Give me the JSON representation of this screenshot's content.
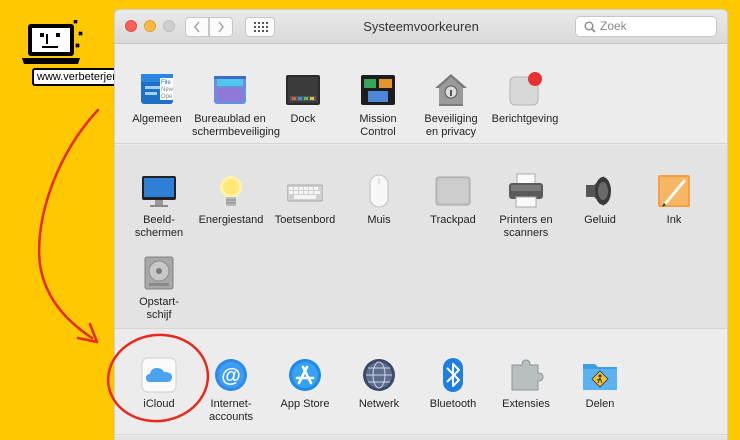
{
  "brand": {
    "url": "www.verbeterjemac.nl"
  },
  "window": {
    "title": "Systeemvoorkeuren",
    "search_placeholder": "Zoek"
  },
  "prefs": {
    "algemeen": "Algemeen",
    "bureaublad_l1": "Bureaublad en",
    "bureaublad_l2": "schermbeveiliging",
    "dock": "Dock",
    "mission_l1": "Mission",
    "mission_l2": "Control",
    "beveiliging_l1": "Beveiliging",
    "beveiliging_l2": "en privacy",
    "berichtgeving": "Berichtgeving",
    "beeld_l1": "Beeld-",
    "beeld_l2": "schermen",
    "energie": "Energiestand",
    "toetsenbord": "Toetsenbord",
    "muis": "Muis",
    "trackpad": "Trackpad",
    "printers_l1": "Printers en",
    "printers_l2": "scanners",
    "geluid": "Geluid",
    "ink": "Ink",
    "opstart_l1": "Opstart-",
    "opstart_l2": "schijf",
    "icloud": "iCloud",
    "internet_l1": "Internet-",
    "internet_l2": "accounts",
    "appstore": "App Store",
    "netwerk": "Netwerk",
    "bluetooth": "Bluetooth",
    "extensies": "Extensies",
    "delen": "Delen"
  },
  "algemeen_icon_text": [
    "File",
    "New",
    "Ope"
  ]
}
